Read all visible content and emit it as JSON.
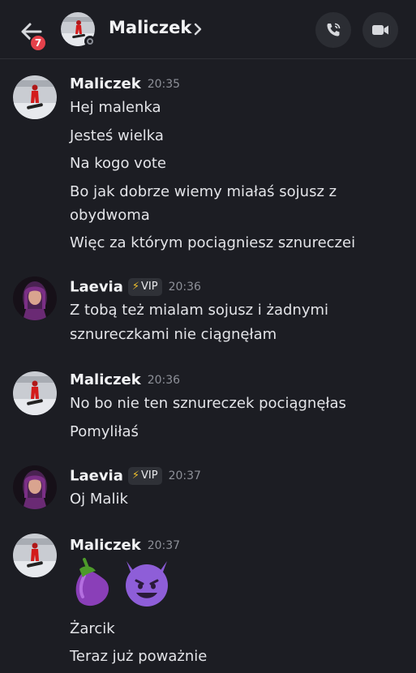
{
  "header": {
    "back_icon": "arrow-left-icon",
    "badge_count": "7",
    "title": "Maliczek",
    "chevron_icon": "chevron-right-icon",
    "call_icon": "phone-icon",
    "video_icon": "video-camera-icon",
    "accent": "#e5414b"
  },
  "messages": [
    {
      "author": "Maliczek",
      "time": "20:35",
      "lines": [
        "Hej malenka",
        "Jesteś wielka",
        "Na kogo vote",
        "Bo jak dobrze wiemy miałaś sojusz z",
        "obydwoma",
        "Więc za którym pociągniesz sznureczei"
      ]
    },
    {
      "author": "Laevia",
      "badge": "VIP",
      "badge_icon": "lightning-icon",
      "time": "20:36",
      "lines": [
        "Z tobą też mialam sojusz i żadnymi",
        "sznureczkami nie ciągnęłam"
      ]
    },
    {
      "author": "Maliczek",
      "time": "20:36",
      "lines": [
        "No bo nie ten sznureczek pociągnęłas",
        "Pomyliłaś"
      ]
    },
    {
      "author": "Laevia",
      "badge": "VIP",
      "badge_icon": "lightning-icon",
      "time": "20:37",
      "lines": [
        "Oj Malik"
      ]
    },
    {
      "author": "Maliczek",
      "time": "20:37",
      "emojis": [
        "eggplant-emoji",
        "smiling-devil-emoji"
      ],
      "lines": [
        "Żarcik",
        "Teraz już poważnie"
      ]
    }
  ]
}
